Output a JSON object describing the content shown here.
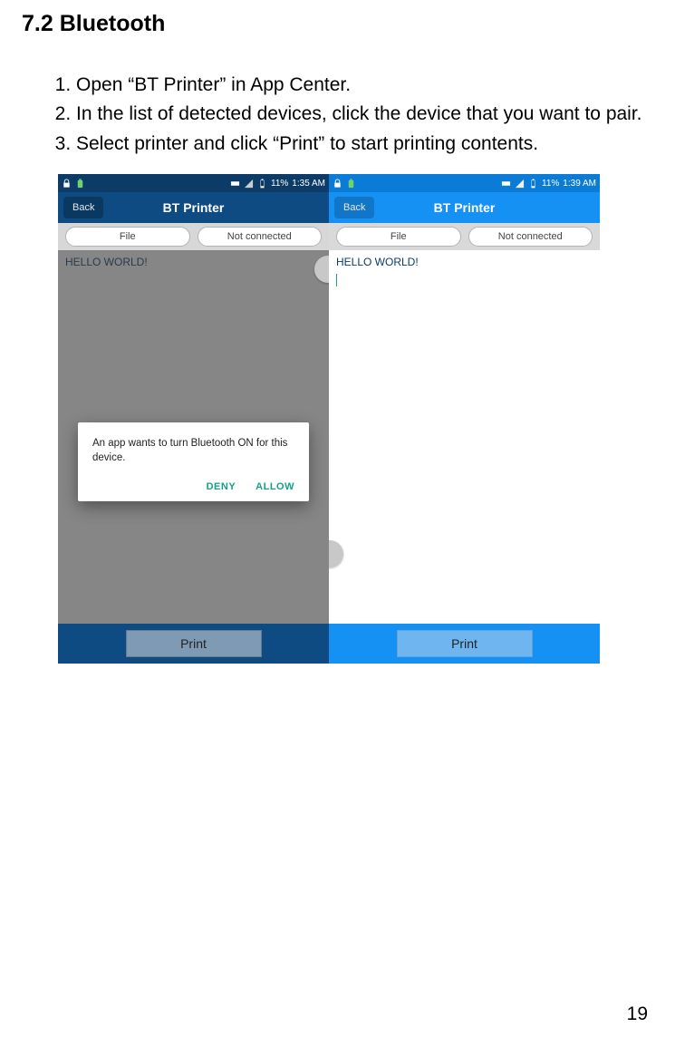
{
  "heading": "7.2 Bluetooth",
  "steps": [
    "Open “BT Printer” in App Center.",
    "In the list of detected devices, click the device that you want to pair.",
    "Select printer and click “Print” to start printing contents."
  ],
  "left": {
    "status": {
      "battery": "11%",
      "time": "1:35 AM"
    },
    "header": {
      "back": "Back",
      "title": "BT Printer"
    },
    "toolbar": {
      "file": "File",
      "status": "Not connected"
    },
    "content": {
      "text": "HELLO WORLD!"
    },
    "dialog": {
      "text": "An app wants to turn Bluetooth ON for this device.",
      "deny": "DENY",
      "allow": "ALLOW"
    },
    "footer": {
      "print": "Print"
    }
  },
  "right": {
    "status": {
      "battery": "11%",
      "time": "1:39 AM"
    },
    "header": {
      "back": "Back",
      "title": "BT Printer"
    },
    "toolbar": {
      "file": "File",
      "status": "Not connected"
    },
    "content": {
      "text": "HELLO WORLD!"
    },
    "footer": {
      "print": "Print"
    }
  },
  "pageNumber": "19"
}
